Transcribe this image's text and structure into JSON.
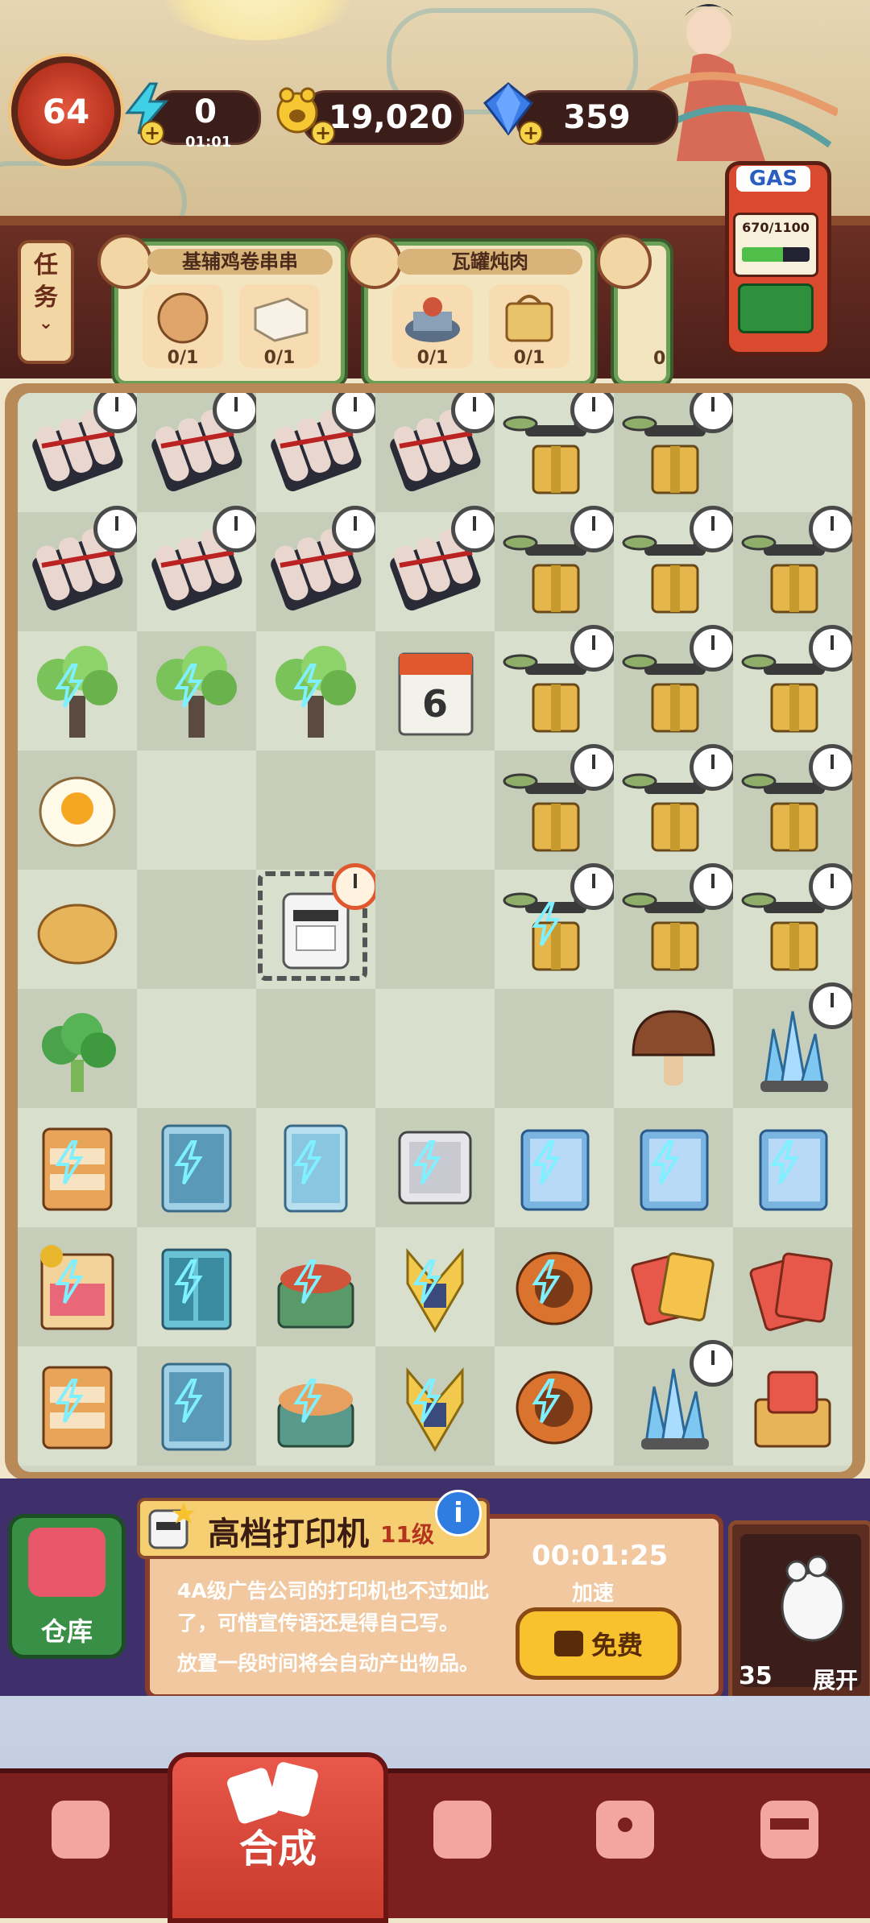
{
  "hud": {
    "level": "64",
    "energy": "0",
    "energy_timer": "01:01",
    "coins": "19,020",
    "gems": "359",
    "gas_label": "GAS",
    "gas_count": "670/1100",
    "gas_fill": 0.61
  },
  "tasks": {
    "tab_label_1": "任",
    "tab_label_2": "务",
    "orders": [
      {
        "title": "基辅鸡卷串串",
        "slots": [
          "0/1",
          "0/1"
        ]
      },
      {
        "title": "瓦罐炖肉",
        "slots": [
          "0/1",
          "0/1"
        ]
      },
      {
        "title": "",
        "slots": [
          "0"
        ]
      }
    ]
  },
  "board": {
    "rows": [
      [
        "dynamite-clock",
        "dynamite-clock",
        "dynamite-clock",
        "dynamite-clock",
        "drone-box-clock",
        "drone-box-clock",
        "empty"
      ],
      [
        "dynamite-clock",
        "dynamite-clock",
        "dynamite-clock",
        "dynamite-clock",
        "drone-box-clock",
        "drone-box-clock",
        "drone-box-clock"
      ],
      [
        "tree-bolt",
        "tree-bolt",
        "tree-bolt",
        "calendar",
        "drone-box-clock",
        "drone-box-clock",
        "drone-box-clock"
      ],
      [
        "egg",
        "empty",
        "empty",
        "empty",
        "drone-box-clock",
        "drone-box-clock",
        "drone-box-clock"
      ],
      [
        "bun",
        "empty",
        "printer-selected",
        "empty",
        "drone-box-bolt-clock",
        "drone-box-clock",
        "drone-box-clock"
      ],
      [
        "broccoli",
        "empty",
        "empty",
        "empty",
        "empty",
        "mushroom",
        "crystal-clock"
      ],
      [
        "shelf-bolt",
        "fridge-bolt",
        "locker-bolt",
        "safe-bolt",
        "notebook-bolt",
        "notebook-bolt",
        "notebook-bolt"
      ],
      [
        "stall-bolt",
        "cabinet-bolt",
        "grill-bolt",
        "wheat-bolt",
        "drum-bolt",
        "cards",
        "cards-red"
      ],
      [
        "shelf-bolt",
        "fridge-bolt",
        "hotpot-bolt",
        "wheat-bolt",
        "drum-bolt",
        "crystal-clock",
        "cards-box"
      ]
    ]
  },
  "info": {
    "title": "高档打印机",
    "level": "11级",
    "description": "4A级广告公司的打印机也不过如此了，可惜宣传语还是得自己写。",
    "hint": "放置一段时间将会自动产出物品。",
    "timer": "00:01:25",
    "speed_label": "加速",
    "free_button": "免费",
    "info_icon": "i",
    "storage_label": "仓库",
    "expand_count": "35",
    "expand_label": "展开"
  },
  "nav": {
    "items": [
      "shop-bag-icon",
      "merge-cards-icon",
      "service-bell-icon",
      "map-pin-icon",
      "bus-icon"
    ],
    "active_label": "合成"
  },
  "colors": {
    "board_light": "#d9dfcd",
    "board_dark": "#c6cdb8",
    "accent_red": "#c73a2c",
    "gold": "#f7c22e"
  }
}
